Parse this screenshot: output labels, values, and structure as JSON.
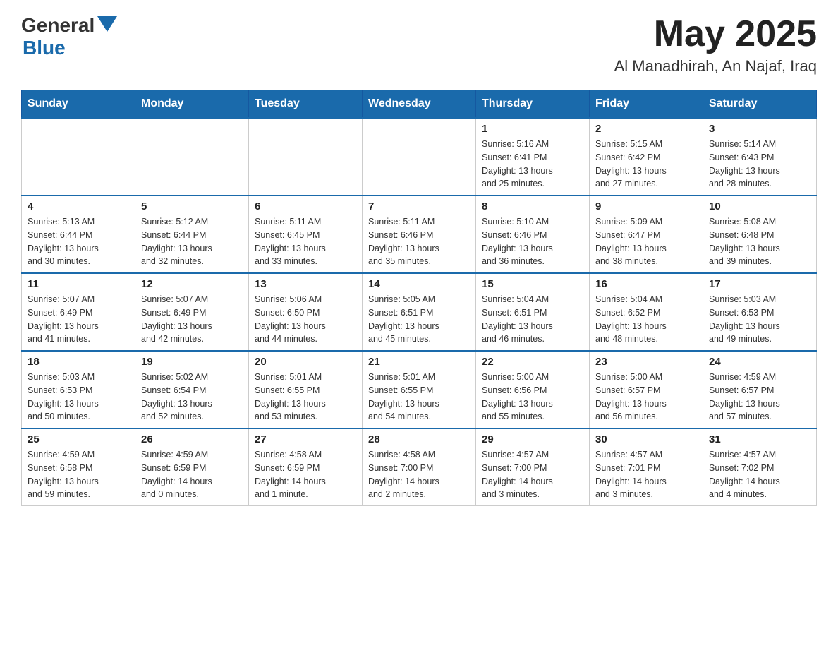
{
  "header": {
    "logo_general": "General",
    "logo_blue": "Blue",
    "month": "May 2025",
    "location": "Al Manadhirah, An Najaf, Iraq"
  },
  "weekdays": [
    "Sunday",
    "Monday",
    "Tuesday",
    "Wednesday",
    "Thursday",
    "Friday",
    "Saturday"
  ],
  "weeks": [
    [
      {
        "day": "",
        "info": ""
      },
      {
        "day": "",
        "info": ""
      },
      {
        "day": "",
        "info": ""
      },
      {
        "day": "",
        "info": ""
      },
      {
        "day": "1",
        "info": "Sunrise: 5:16 AM\nSunset: 6:41 PM\nDaylight: 13 hours\nand 25 minutes."
      },
      {
        "day": "2",
        "info": "Sunrise: 5:15 AM\nSunset: 6:42 PM\nDaylight: 13 hours\nand 27 minutes."
      },
      {
        "day": "3",
        "info": "Sunrise: 5:14 AM\nSunset: 6:43 PM\nDaylight: 13 hours\nand 28 minutes."
      }
    ],
    [
      {
        "day": "4",
        "info": "Sunrise: 5:13 AM\nSunset: 6:44 PM\nDaylight: 13 hours\nand 30 minutes."
      },
      {
        "day": "5",
        "info": "Sunrise: 5:12 AM\nSunset: 6:44 PM\nDaylight: 13 hours\nand 32 minutes."
      },
      {
        "day": "6",
        "info": "Sunrise: 5:11 AM\nSunset: 6:45 PM\nDaylight: 13 hours\nand 33 minutes."
      },
      {
        "day": "7",
        "info": "Sunrise: 5:11 AM\nSunset: 6:46 PM\nDaylight: 13 hours\nand 35 minutes."
      },
      {
        "day": "8",
        "info": "Sunrise: 5:10 AM\nSunset: 6:46 PM\nDaylight: 13 hours\nand 36 minutes."
      },
      {
        "day": "9",
        "info": "Sunrise: 5:09 AM\nSunset: 6:47 PM\nDaylight: 13 hours\nand 38 minutes."
      },
      {
        "day": "10",
        "info": "Sunrise: 5:08 AM\nSunset: 6:48 PM\nDaylight: 13 hours\nand 39 minutes."
      }
    ],
    [
      {
        "day": "11",
        "info": "Sunrise: 5:07 AM\nSunset: 6:49 PM\nDaylight: 13 hours\nand 41 minutes."
      },
      {
        "day": "12",
        "info": "Sunrise: 5:07 AM\nSunset: 6:49 PM\nDaylight: 13 hours\nand 42 minutes."
      },
      {
        "day": "13",
        "info": "Sunrise: 5:06 AM\nSunset: 6:50 PM\nDaylight: 13 hours\nand 44 minutes."
      },
      {
        "day": "14",
        "info": "Sunrise: 5:05 AM\nSunset: 6:51 PM\nDaylight: 13 hours\nand 45 minutes."
      },
      {
        "day": "15",
        "info": "Sunrise: 5:04 AM\nSunset: 6:51 PM\nDaylight: 13 hours\nand 46 minutes."
      },
      {
        "day": "16",
        "info": "Sunrise: 5:04 AM\nSunset: 6:52 PM\nDaylight: 13 hours\nand 48 minutes."
      },
      {
        "day": "17",
        "info": "Sunrise: 5:03 AM\nSunset: 6:53 PM\nDaylight: 13 hours\nand 49 minutes."
      }
    ],
    [
      {
        "day": "18",
        "info": "Sunrise: 5:03 AM\nSunset: 6:53 PM\nDaylight: 13 hours\nand 50 minutes."
      },
      {
        "day": "19",
        "info": "Sunrise: 5:02 AM\nSunset: 6:54 PM\nDaylight: 13 hours\nand 52 minutes."
      },
      {
        "day": "20",
        "info": "Sunrise: 5:01 AM\nSunset: 6:55 PM\nDaylight: 13 hours\nand 53 minutes."
      },
      {
        "day": "21",
        "info": "Sunrise: 5:01 AM\nSunset: 6:55 PM\nDaylight: 13 hours\nand 54 minutes."
      },
      {
        "day": "22",
        "info": "Sunrise: 5:00 AM\nSunset: 6:56 PM\nDaylight: 13 hours\nand 55 minutes."
      },
      {
        "day": "23",
        "info": "Sunrise: 5:00 AM\nSunset: 6:57 PM\nDaylight: 13 hours\nand 56 minutes."
      },
      {
        "day": "24",
        "info": "Sunrise: 4:59 AM\nSunset: 6:57 PM\nDaylight: 13 hours\nand 57 minutes."
      }
    ],
    [
      {
        "day": "25",
        "info": "Sunrise: 4:59 AM\nSunset: 6:58 PM\nDaylight: 13 hours\nand 59 minutes."
      },
      {
        "day": "26",
        "info": "Sunrise: 4:59 AM\nSunset: 6:59 PM\nDaylight: 14 hours\nand 0 minutes."
      },
      {
        "day": "27",
        "info": "Sunrise: 4:58 AM\nSunset: 6:59 PM\nDaylight: 14 hours\nand 1 minute."
      },
      {
        "day": "28",
        "info": "Sunrise: 4:58 AM\nSunset: 7:00 PM\nDaylight: 14 hours\nand 2 minutes."
      },
      {
        "day": "29",
        "info": "Sunrise: 4:57 AM\nSunset: 7:00 PM\nDaylight: 14 hours\nand 3 minutes."
      },
      {
        "day": "30",
        "info": "Sunrise: 4:57 AM\nSunset: 7:01 PM\nDaylight: 14 hours\nand 3 minutes."
      },
      {
        "day": "31",
        "info": "Sunrise: 4:57 AM\nSunset: 7:02 PM\nDaylight: 14 hours\nand 4 minutes."
      }
    ]
  ]
}
